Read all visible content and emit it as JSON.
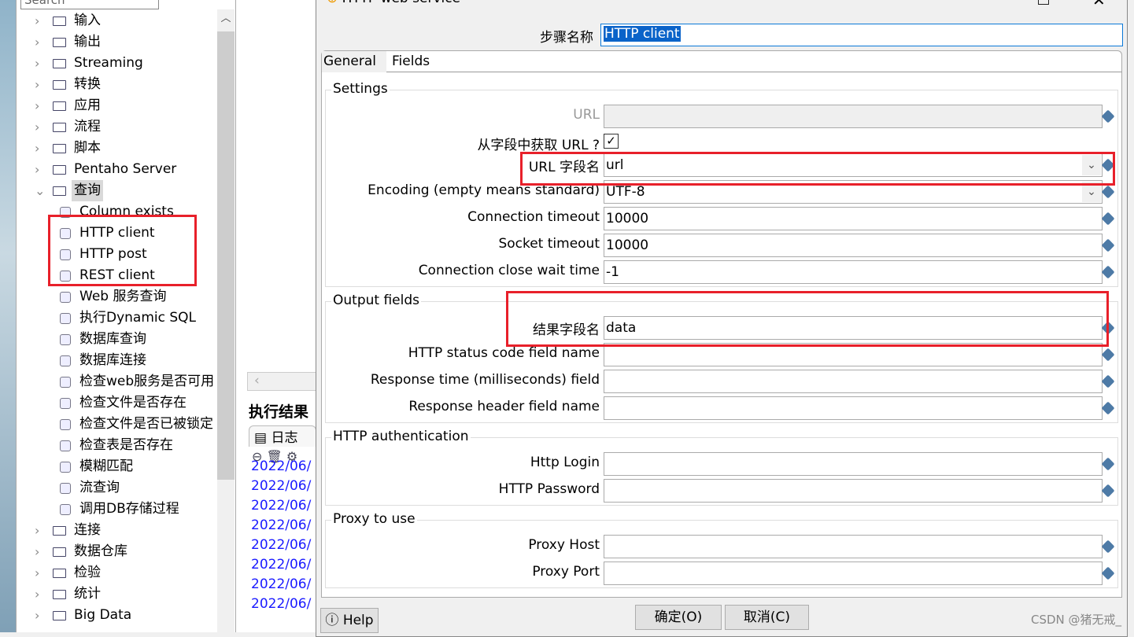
{
  "tree": {
    "search_placeholder": "Search",
    "folders_top": [
      "输入",
      "输出",
      "Streaming",
      "转换",
      "应用",
      "流程",
      "脚本",
      "Pentaho Server"
    ],
    "open_folder": "查询",
    "leaves": [
      "Column exists",
      "HTTP client",
      "HTTP post",
      "REST client",
      "Web 服务查询",
      "执行Dynamic SQL",
      "数据库查询",
      "数据库连接",
      "检查web服务是否可用",
      "检查文件是否存在",
      "检查文件是否已被锁定",
      "检查表是否存在",
      "模糊匹配",
      "流查询",
      "调用DB存储过程"
    ],
    "folders_bottom": [
      "连接",
      "数据仓库",
      "检验",
      "统计",
      "Big Data"
    ]
  },
  "results": {
    "title": "执行结果",
    "log_tab": "日志",
    "log_lines": [
      "2022/06/",
      "2022/06/",
      "2022/06/",
      "2022/06/",
      "2022/06/",
      "2022/06/",
      "2022/06/",
      "2022/06/"
    ]
  },
  "dialog": {
    "title": "HTTP web service",
    "step_name_label": "步骤名称",
    "step_name": "HTTP client",
    "tabs": [
      "General",
      "Fields"
    ],
    "settings": {
      "title": "Settings",
      "url_label": "URL",
      "url": "",
      "from_field_label": "从字段中获取 URL ?",
      "from_field_checked": true,
      "url_field_label": "URL 字段名",
      "url_field": "url",
      "encoding_label": "Encoding (empty means standard)",
      "encoding": "UTF-8",
      "conn_timeout_label": "Connection timeout",
      "conn_timeout": "10000",
      "socket_timeout_label": "Socket timeout",
      "socket_timeout": "10000",
      "close_wait_label": "Connection close wait time",
      "close_wait": "-1"
    },
    "output": {
      "title": "Output fields",
      "result_label": "结果字段名",
      "result": "data",
      "status_label": "HTTP status code field name",
      "status": "",
      "resp_time_label": "Response time (milliseconds) field",
      "resp_time": "",
      "header_label": "Response header field name",
      "header": ""
    },
    "auth": {
      "title": "HTTP authentication",
      "login_label": "Http Login",
      "login": "",
      "password_label": "HTTP Password",
      "password": ""
    },
    "proxy": {
      "title": "Proxy to use",
      "host_label": "Proxy Host",
      "host": "",
      "port_label": "Proxy Port",
      "port": ""
    },
    "help": "Help",
    "ok": "确定(O)",
    "cancel": "取消(C)"
  },
  "watermark": "CSDN @猪无戒_",
  "colors": {
    "highlight_box": "#e8202a",
    "selection": "#0a63c9",
    "log_text": "#1a1aff"
  }
}
